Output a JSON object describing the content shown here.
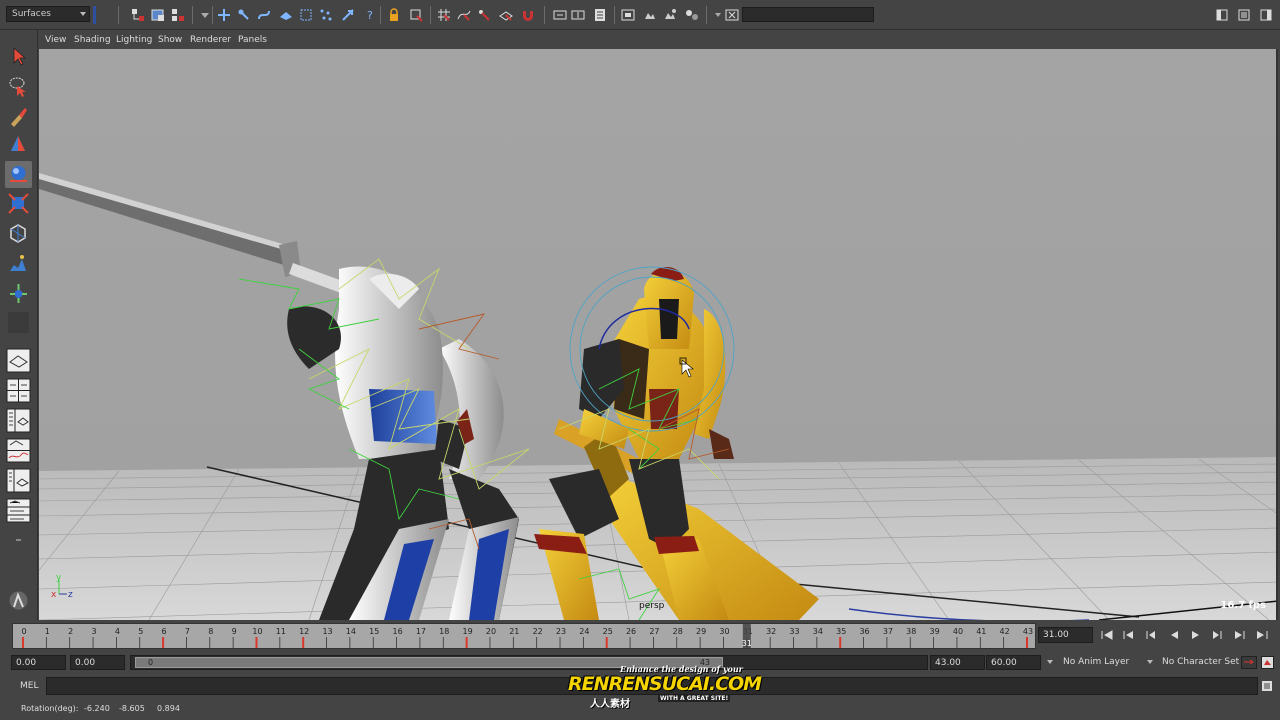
{
  "statusline": {
    "menu_set": "Surfaces",
    "icons": [
      "select-by-hierarchy-icon",
      "select-by-object-icon",
      "select-by-component-icon",
      "mask-icon",
      "snap-grid-icon",
      "snap-curve-icon",
      "snap-point-icon",
      "snap-plane-icon",
      "history-icon",
      "render-icon",
      "ipr-icon",
      "render-settings-icon",
      "hypershade-icon",
      "sidebar-toggle-icon"
    ]
  },
  "panel_menu": [
    "View",
    "Shading",
    "Lighting",
    "Show",
    "Renderer",
    "Panels"
  ],
  "toolbox": [
    "select-tool-icon",
    "lasso-tool-icon",
    "paint-select-tool-icon",
    "move-tool-icon",
    "rotate-tool-icon",
    "scale-tool-icon",
    "universal-manipulator-icon",
    "soft-mod-icon",
    "show-manipulator-icon",
    "last-tool-icon",
    "single-perspective-layout-icon",
    "four-view-layout-icon",
    "outliner-layout-icon",
    "graph-editor-layout-icon",
    "hypershade-layout-icon",
    "custom-layout-icon",
    "quick-layout-icon"
  ],
  "viewport": {
    "camera": "persp",
    "fps": "16.7 fps",
    "axis_y": "y",
    "axis_x": "x",
    "axis_z": "z",
    "bg_color": "#a3a3a3"
  },
  "timeline": {
    "start": 0,
    "end": 43,
    "current": 31,
    "current_label": "31",
    "keys": [
      0,
      6,
      10,
      12,
      19,
      25,
      35,
      43
    ],
    "current_time": "31.00"
  },
  "range": {
    "start_time": "0.00",
    "playback_start": "0.00",
    "range_start": "0",
    "range_end": "43",
    "playback_end": "43.00",
    "end_time": "60.00",
    "anim_layer": "No Anim Layer",
    "character_set": "No Character Set"
  },
  "command": {
    "label": "MEL"
  },
  "help": {
    "label": "Rotation(deg):",
    "x": "-6.240",
    "y": "-8.605",
    "z": "0.894"
  },
  "watermark": {
    "tagline": "Enhance the design of your",
    "brand": "RENRENSUCAI.COM",
    "chinese": "人人素材",
    "sub": "WITH A GREAT SITE!"
  }
}
